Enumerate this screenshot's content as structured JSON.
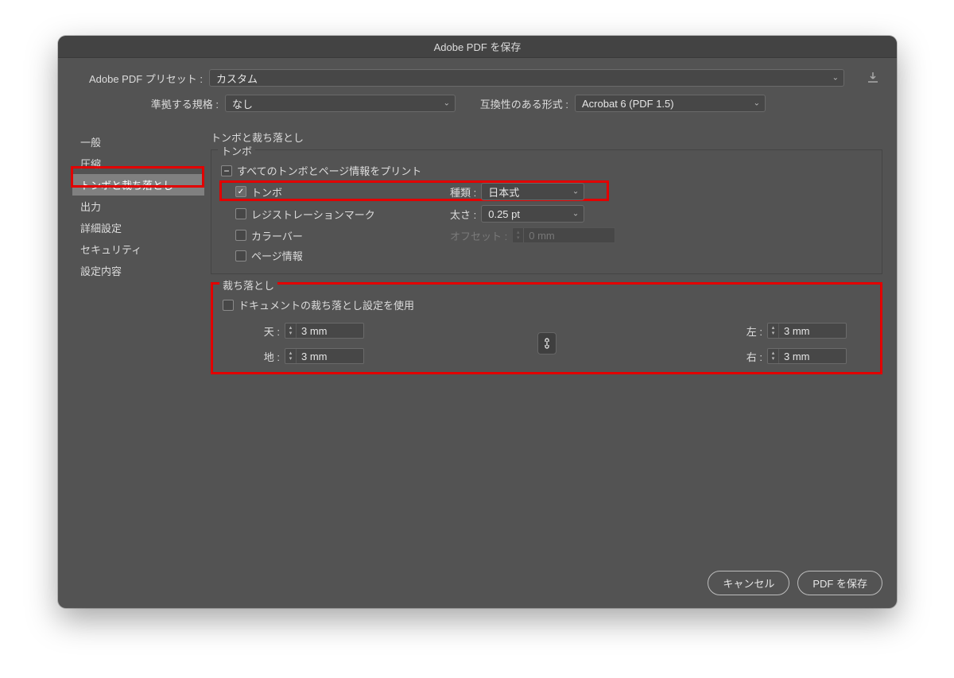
{
  "title": "Adobe PDF を保存",
  "preset": {
    "label": "Adobe PDF プリセット :",
    "value": "カスタム"
  },
  "standardLabel": "準拠する規格 :",
  "standardValue": "なし",
  "compatLabel": "互換性のある形式 :",
  "compatValue": "Acrobat 6 (PDF 1.5)",
  "sidebar": [
    "一般",
    "圧縮",
    "トンボと裁ち落とし",
    "出力",
    "詳細設定",
    "セキュリティ",
    "設定内容"
  ],
  "sectionTitle": "トンボと裁ち落とし",
  "marks": {
    "groupLabel": "トンボ",
    "printAll": "すべてのトンボとページ情報をプリント",
    "trim": "トンボ",
    "reg": "レジストレーションマーク",
    "colorbar": "カラーバー",
    "pageinfo": "ページ情報",
    "typeLabel": "種類 :",
    "typeValue": "日本式",
    "weightLabel": "太さ :",
    "weightValue": "0.25 pt",
    "offsetLabel": "オフセット :",
    "offsetValue": "0 mm"
  },
  "bleed": {
    "groupLabel": "裁ち落とし",
    "useDoc": "ドキュメントの裁ち落とし設定を使用",
    "top": {
      "label": "天 :",
      "value": "3 mm"
    },
    "bottom": {
      "label": "地 :",
      "value": "3 mm"
    },
    "left": {
      "label": "左 :",
      "value": "3 mm"
    },
    "right": {
      "label": "右 :",
      "value": "3 mm"
    }
  },
  "buttons": {
    "cancel": "キャンセル",
    "save": "PDF を保存"
  }
}
